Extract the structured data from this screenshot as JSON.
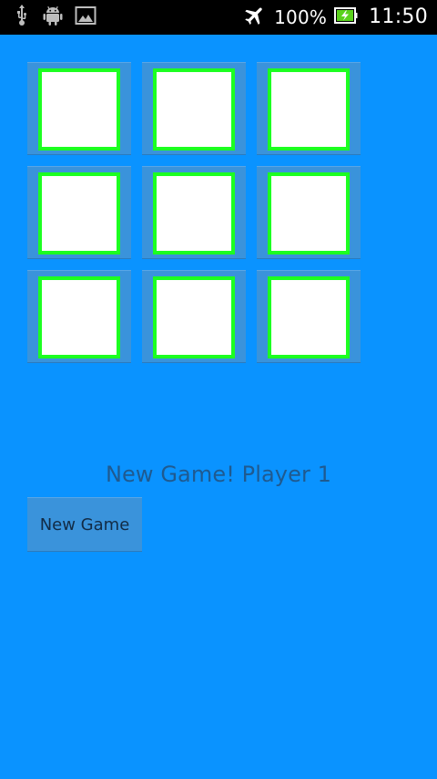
{
  "status_bar": {
    "left_icons": [
      "usb-icon",
      "android-icon",
      "image-icon"
    ],
    "right_icons": [
      "airplane-icon",
      "battery-charging-icon"
    ],
    "battery_text": "100%",
    "time": "11:50"
  },
  "board": {
    "cells": [
      {
        "mark": ""
      },
      {
        "mark": ""
      },
      {
        "mark": ""
      },
      {
        "mark": ""
      },
      {
        "mark": ""
      },
      {
        "mark": ""
      },
      {
        "mark": ""
      },
      {
        "mark": ""
      },
      {
        "mark": ""
      }
    ]
  },
  "game": {
    "status_text": "New Game! Player 1",
    "new_game_label": "New Game"
  },
  "colors": {
    "background": "#0a93ff",
    "cell_background": "#3a93db",
    "cell_border": "#1cff21",
    "cell_fill": "#ffffff",
    "status_text": "#1f5a90",
    "button_text": "#122b45"
  }
}
